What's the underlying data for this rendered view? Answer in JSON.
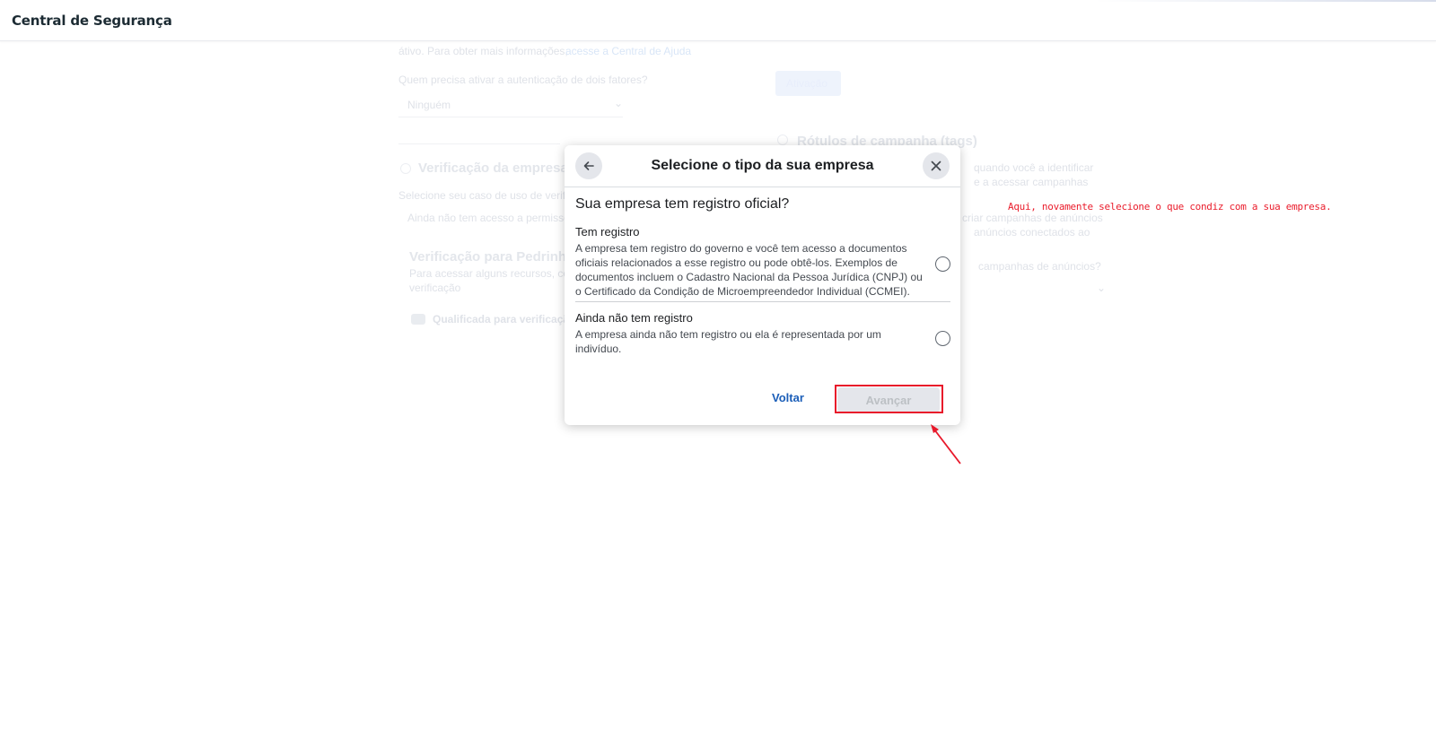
{
  "app": {
    "title": "Central de Segurança"
  },
  "background": {
    "line1_a": "átivo. Para obter mais informações,",
    "line1_b": "acesse a Central de Ajuda",
    "label_two_factor": "Quem precisa ativar a autenticação de dois fatores?",
    "select_value": "Ninguém",
    "button_label": "Ativação",
    "heading_verificacao": "Verificação da empresa",
    "heading_rotulos": "Rótulos de campanha (tags)",
    "text_selecione": "Selecione seu caso de uso de verificação",
    "text_acesso": "Ainda não tem acesso a permissões",
    "heading_pedrinho": "Verificação para Pedrinho",
    "text_pedrinho_a": "Para acessar alguns recursos, conclua a",
    "text_pedrinho_b": "verificação",
    "text_qualificada": "Qualificada para verificação",
    "text_right1": "quando você a identificar",
    "text_right2": "e a acessar campanhas",
    "text_right3": "criar campanhas de anúncios",
    "text_right4": "anúncios conectados ao",
    "text_right5": "campanhas de anúncios?"
  },
  "modal": {
    "title": "Selecione o tipo da sua empresa",
    "question": "Sua empresa tem registro oficial?",
    "options": [
      {
        "title": "Tem registro",
        "description": "A empresa tem registro do governo e você tem acesso a documentos oficiais relacionados a esse registro ou pode obtê-los. Exemplos de documentos incluem o Cadastro Nacional da Pessoa Jurídica (CNPJ) ou o Certificado da Condição de Microempreendedor Individual (CCMEI)."
      },
      {
        "title": "Ainda não tem registro",
        "description": "A empresa ainda não tem registro ou ela é representada por um indivíduo."
      }
    ],
    "back_label": "Voltar",
    "next_label": "Avançar"
  },
  "annotation": {
    "text": "Aqui, novamente selecione o que condiz com a sua empresa.",
    "color": "#ea1d2c"
  },
  "icons": {
    "back": "arrow-left-icon",
    "close": "close-icon"
  }
}
